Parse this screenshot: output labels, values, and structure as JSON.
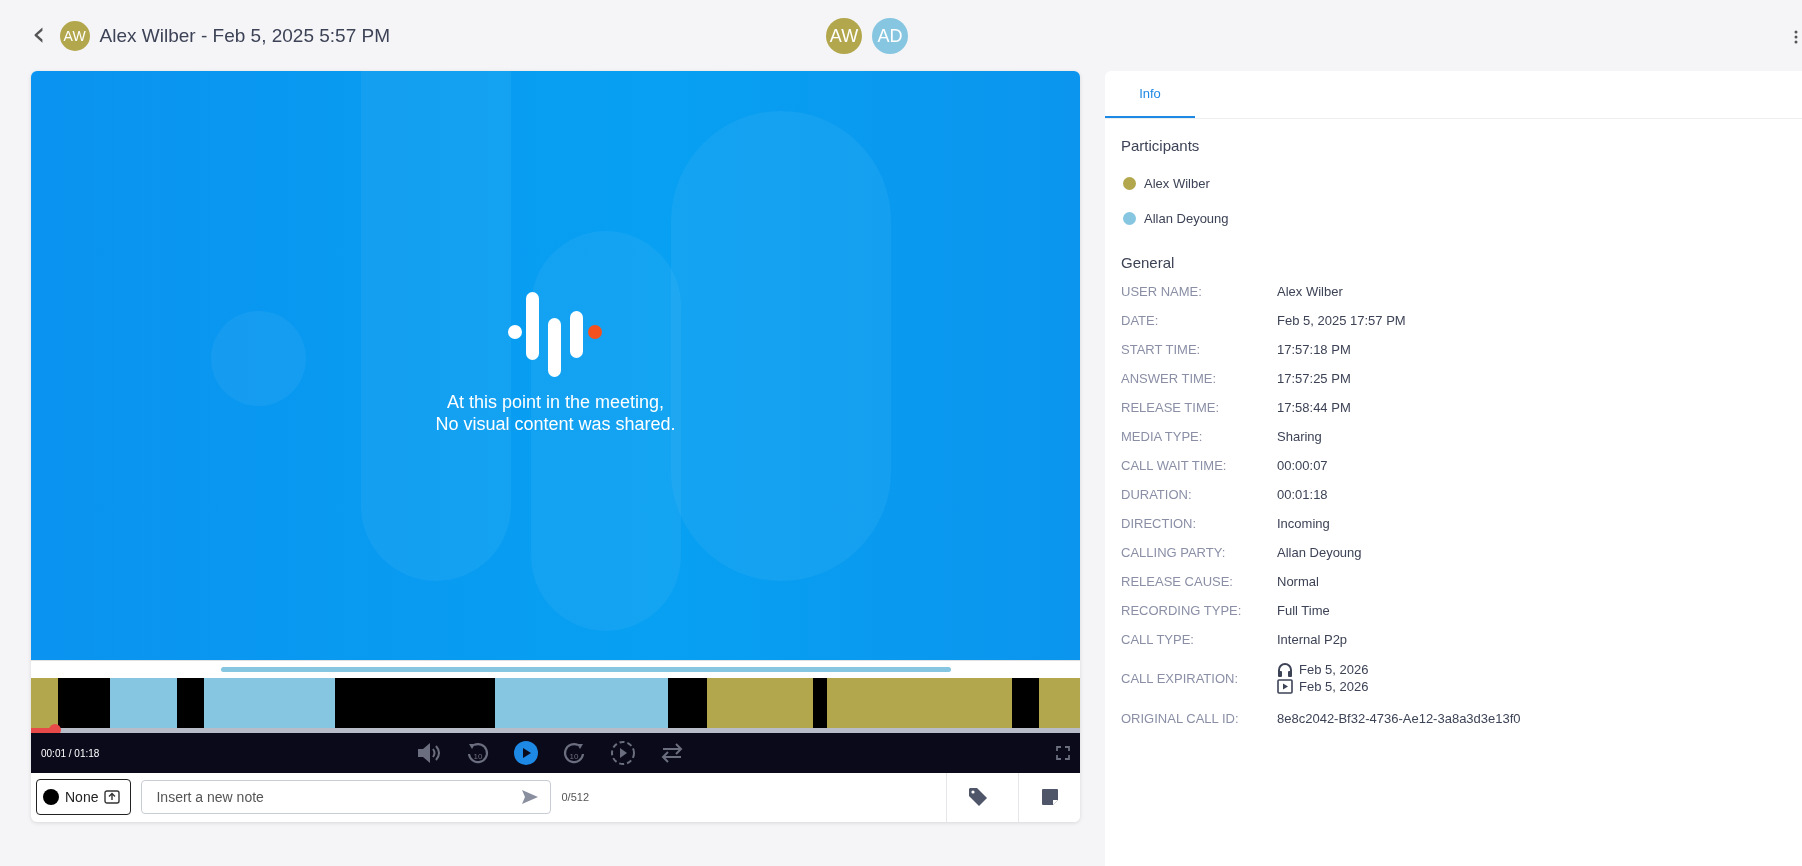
{
  "header": {
    "back_label": "‹",
    "avatar": {
      "initials": "AW",
      "color": "#b3a74d"
    },
    "title": "Alex Wilber - Feb 5, 2025 5:57 PM",
    "participants": [
      {
        "initials": "AW",
        "color": "#b3a74d"
      },
      {
        "initials": "AD",
        "color": "#86c6e0"
      }
    ]
  },
  "video": {
    "message": [
      "At this point in the meeting,",
      "No visual content was shared."
    ],
    "timeline": [
      {
        "color": "#b3a74d"
      },
      {
        "color": "#000000"
      },
      {
        "color": "#86c6e0"
      },
      {
        "color": "#000000"
      },
      {
        "color": "#86c6e0"
      },
      {
        "color": "#000000"
      },
      {
        "color": "#86c6e0"
      },
      {
        "color": "#000000"
      },
      {
        "color": "#b3a74d"
      },
      {
        "color": "#000000"
      },
      {
        "color": "#b3a74d"
      },
      {
        "color": "#000000"
      },
      {
        "color": "#b3a74d"
      }
    ],
    "progress": {
      "level": 0.023
    },
    "time": "00:01 / 01:18",
    "rewind_label": "10",
    "forward_label": "10"
  },
  "notes": {
    "category": {
      "label": "None",
      "color": "#000000"
    },
    "placeholder": "Insert a new note",
    "counter": "0/512"
  },
  "info": {
    "tabs": [
      {
        "label": "Info",
        "selected": true
      }
    ],
    "participants_title": "Participants",
    "participants": [
      {
        "name": "Alex Wilber",
        "color": "#b3a74d"
      },
      {
        "name": "Allan Deyoung",
        "color": "#86c6e0"
      }
    ],
    "general_title": "General",
    "rows": [
      {
        "label": "USER NAME:",
        "values": [
          {
            "kind": "plain",
            "text": "Alex Wilber"
          }
        ]
      },
      {
        "label": "DATE:",
        "values": [
          {
            "kind": "plain",
            "text": "Feb 5, 2025 17:57 PM"
          }
        ]
      },
      {
        "label": "START TIME:",
        "values": [
          {
            "kind": "plain",
            "text": "17:57:18 PM"
          }
        ]
      },
      {
        "label": "ANSWER TIME:",
        "values": [
          {
            "kind": "plain",
            "text": "17:57:25 PM"
          }
        ]
      },
      {
        "label": "RELEASE TIME:",
        "values": [
          {
            "kind": "plain",
            "text": "17:58:44 PM"
          }
        ]
      },
      {
        "label": "MEDIA TYPE:",
        "values": [
          {
            "kind": "plain",
            "text": "Sharing"
          }
        ]
      },
      {
        "label": "CALL WAIT TIME:",
        "values": [
          {
            "kind": "plain",
            "text": "00:00:07"
          }
        ]
      },
      {
        "label": "DURATION:",
        "values": [
          {
            "kind": "plain",
            "text": "00:01:18"
          }
        ]
      },
      {
        "label": "DIRECTION:",
        "values": [
          {
            "kind": "plain",
            "text": "Incoming"
          }
        ]
      },
      {
        "label": "CALLING PARTY:",
        "values": [
          {
            "kind": "plain",
            "text": "Allan Deyoung"
          }
        ]
      },
      {
        "label": "RELEASE CAUSE:",
        "values": [
          {
            "kind": "plain",
            "text": "Normal"
          }
        ]
      },
      {
        "label": "RECORDING TYPE:",
        "values": [
          {
            "kind": "plain",
            "text": "Full Time"
          }
        ]
      },
      {
        "label": "CALL TYPE:",
        "values": [
          {
            "kind": "plain",
            "text": "Internal P2p"
          }
        ]
      },
      {
        "label": "CALL EXPIRATION:",
        "values": [
          {
            "kind": "audio",
            "text": "Feb 5, 2026"
          },
          {
            "kind": "video",
            "text": "Feb 5, 2026"
          }
        ]
      },
      {
        "label": "ORIGINAL CALL ID:",
        "values": [
          {
            "kind": "plain",
            "text": "8e8c2042-Bf32-4736-Ae12-3a8a3d3e13f0"
          }
        ]
      }
    ]
  }
}
